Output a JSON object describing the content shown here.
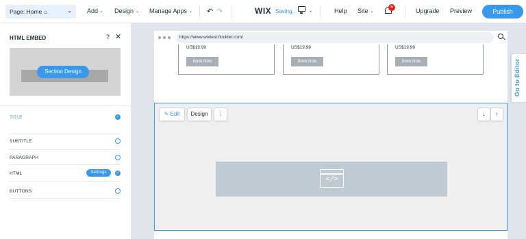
{
  "topbar": {
    "page_label": "Page: Home",
    "home_glyph": "⌂",
    "menus": [
      "Add",
      "Design",
      "Manage Apps"
    ],
    "logo": "WIX",
    "saving": "Saving..",
    "help": "Help",
    "site": "Site",
    "notification_count": "6",
    "upgrade": "Upgrade",
    "preview": "Preview",
    "publish": "Publish"
  },
  "panel": {
    "title": "HTML EMBED",
    "help_glyph": "?",
    "close_glyph": "✕",
    "preview_button": "Section Design",
    "rows": [
      {
        "label": "TITLE",
        "checked": true
      },
      {
        "label": "SUBTITLE",
        "checked": false
      },
      {
        "label": "PARAGRAPH",
        "checked": false
      },
      {
        "label": "HTML",
        "checked": true,
        "settings": "Settings"
      },
      {
        "label": "BUTTONS",
        "checked": false
      }
    ]
  },
  "browser": {
    "url": "https://www.wixtest.flockler.com/"
  },
  "cards": [
    {
      "price": "US$19.99",
      "button": "Book Now"
    },
    {
      "price": "US$19.99",
      "button": "Book Now"
    },
    {
      "price": "US$19.99",
      "button": "Book Now"
    }
  ],
  "strip_toolbar": {
    "edit": "Edit",
    "design": "Design",
    "more": "⋮",
    "down": "↓",
    "up": "↑"
  },
  "embed": {
    "glyph": "</>"
  },
  "side_tab": "Go to Editor",
  "colors": {
    "accent": "#3899ec",
    "badge": "#e62214",
    "embed_fill": "#bfcad3"
  },
  "icons": {
    "check": "✓",
    "chevron": "⌄",
    "undo": "↶",
    "redo": "↷",
    "pencil": "✎"
  }
}
